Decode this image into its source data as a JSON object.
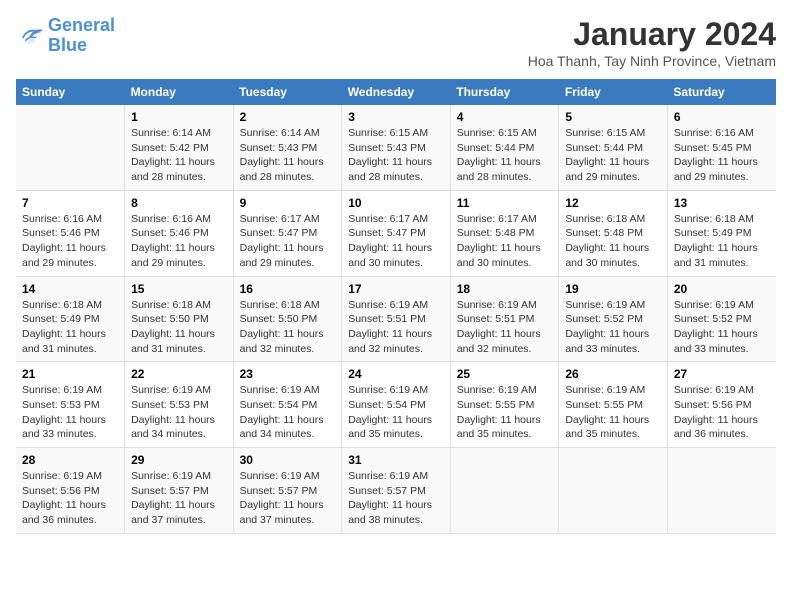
{
  "logo": {
    "line1": "General",
    "line2": "Blue"
  },
  "title": "January 2024",
  "subtitle": "Hoa Thanh, Tay Ninh Province, Vietnam",
  "days": [
    "Sunday",
    "Monday",
    "Tuesday",
    "Wednesday",
    "Thursday",
    "Friday",
    "Saturday"
  ],
  "weeks": [
    [
      {
        "day": "",
        "content": ""
      },
      {
        "day": "1",
        "content": "Sunrise: 6:14 AM\nSunset: 5:42 PM\nDaylight: 11 hours\nand 28 minutes."
      },
      {
        "day": "2",
        "content": "Sunrise: 6:14 AM\nSunset: 5:43 PM\nDaylight: 11 hours\nand 28 minutes."
      },
      {
        "day": "3",
        "content": "Sunrise: 6:15 AM\nSunset: 5:43 PM\nDaylight: 11 hours\nand 28 minutes."
      },
      {
        "day": "4",
        "content": "Sunrise: 6:15 AM\nSunset: 5:44 PM\nDaylight: 11 hours\nand 28 minutes."
      },
      {
        "day": "5",
        "content": "Sunrise: 6:15 AM\nSunset: 5:44 PM\nDaylight: 11 hours\nand 29 minutes."
      },
      {
        "day": "6",
        "content": "Sunrise: 6:16 AM\nSunset: 5:45 PM\nDaylight: 11 hours\nand 29 minutes."
      }
    ],
    [
      {
        "day": "7",
        "content": "Sunrise: 6:16 AM\nSunset: 5:46 PM\nDaylight: 11 hours\nand 29 minutes."
      },
      {
        "day": "8",
        "content": "Sunrise: 6:16 AM\nSunset: 5:46 PM\nDaylight: 11 hours\nand 29 minutes."
      },
      {
        "day": "9",
        "content": "Sunrise: 6:17 AM\nSunset: 5:47 PM\nDaylight: 11 hours\nand 29 minutes."
      },
      {
        "day": "10",
        "content": "Sunrise: 6:17 AM\nSunset: 5:47 PM\nDaylight: 11 hours\nand 30 minutes."
      },
      {
        "day": "11",
        "content": "Sunrise: 6:17 AM\nSunset: 5:48 PM\nDaylight: 11 hours\nand 30 minutes."
      },
      {
        "day": "12",
        "content": "Sunrise: 6:18 AM\nSunset: 5:48 PM\nDaylight: 11 hours\nand 30 minutes."
      },
      {
        "day": "13",
        "content": "Sunrise: 6:18 AM\nSunset: 5:49 PM\nDaylight: 11 hours\nand 31 minutes."
      }
    ],
    [
      {
        "day": "14",
        "content": "Sunrise: 6:18 AM\nSunset: 5:49 PM\nDaylight: 11 hours\nand 31 minutes."
      },
      {
        "day": "15",
        "content": "Sunrise: 6:18 AM\nSunset: 5:50 PM\nDaylight: 11 hours\nand 31 minutes."
      },
      {
        "day": "16",
        "content": "Sunrise: 6:18 AM\nSunset: 5:50 PM\nDaylight: 11 hours\nand 32 minutes."
      },
      {
        "day": "17",
        "content": "Sunrise: 6:19 AM\nSunset: 5:51 PM\nDaylight: 11 hours\nand 32 minutes."
      },
      {
        "day": "18",
        "content": "Sunrise: 6:19 AM\nSunset: 5:51 PM\nDaylight: 11 hours\nand 32 minutes."
      },
      {
        "day": "19",
        "content": "Sunrise: 6:19 AM\nSunset: 5:52 PM\nDaylight: 11 hours\nand 33 minutes."
      },
      {
        "day": "20",
        "content": "Sunrise: 6:19 AM\nSunset: 5:52 PM\nDaylight: 11 hours\nand 33 minutes."
      }
    ],
    [
      {
        "day": "21",
        "content": "Sunrise: 6:19 AM\nSunset: 5:53 PM\nDaylight: 11 hours\nand 33 minutes."
      },
      {
        "day": "22",
        "content": "Sunrise: 6:19 AM\nSunset: 5:53 PM\nDaylight: 11 hours\nand 34 minutes."
      },
      {
        "day": "23",
        "content": "Sunrise: 6:19 AM\nSunset: 5:54 PM\nDaylight: 11 hours\nand 34 minutes."
      },
      {
        "day": "24",
        "content": "Sunrise: 6:19 AM\nSunset: 5:54 PM\nDaylight: 11 hours\nand 35 minutes."
      },
      {
        "day": "25",
        "content": "Sunrise: 6:19 AM\nSunset: 5:55 PM\nDaylight: 11 hours\nand 35 minutes."
      },
      {
        "day": "26",
        "content": "Sunrise: 6:19 AM\nSunset: 5:55 PM\nDaylight: 11 hours\nand 35 minutes."
      },
      {
        "day": "27",
        "content": "Sunrise: 6:19 AM\nSunset: 5:56 PM\nDaylight: 11 hours\nand 36 minutes."
      }
    ],
    [
      {
        "day": "28",
        "content": "Sunrise: 6:19 AM\nSunset: 5:56 PM\nDaylight: 11 hours\nand 36 minutes."
      },
      {
        "day": "29",
        "content": "Sunrise: 6:19 AM\nSunset: 5:57 PM\nDaylight: 11 hours\nand 37 minutes."
      },
      {
        "day": "30",
        "content": "Sunrise: 6:19 AM\nSunset: 5:57 PM\nDaylight: 11 hours\nand 37 minutes."
      },
      {
        "day": "31",
        "content": "Sunrise: 6:19 AM\nSunset: 5:57 PM\nDaylight: 11 hours\nand 38 minutes."
      },
      {
        "day": "",
        "content": ""
      },
      {
        "day": "",
        "content": ""
      },
      {
        "day": "",
        "content": ""
      }
    ]
  ]
}
